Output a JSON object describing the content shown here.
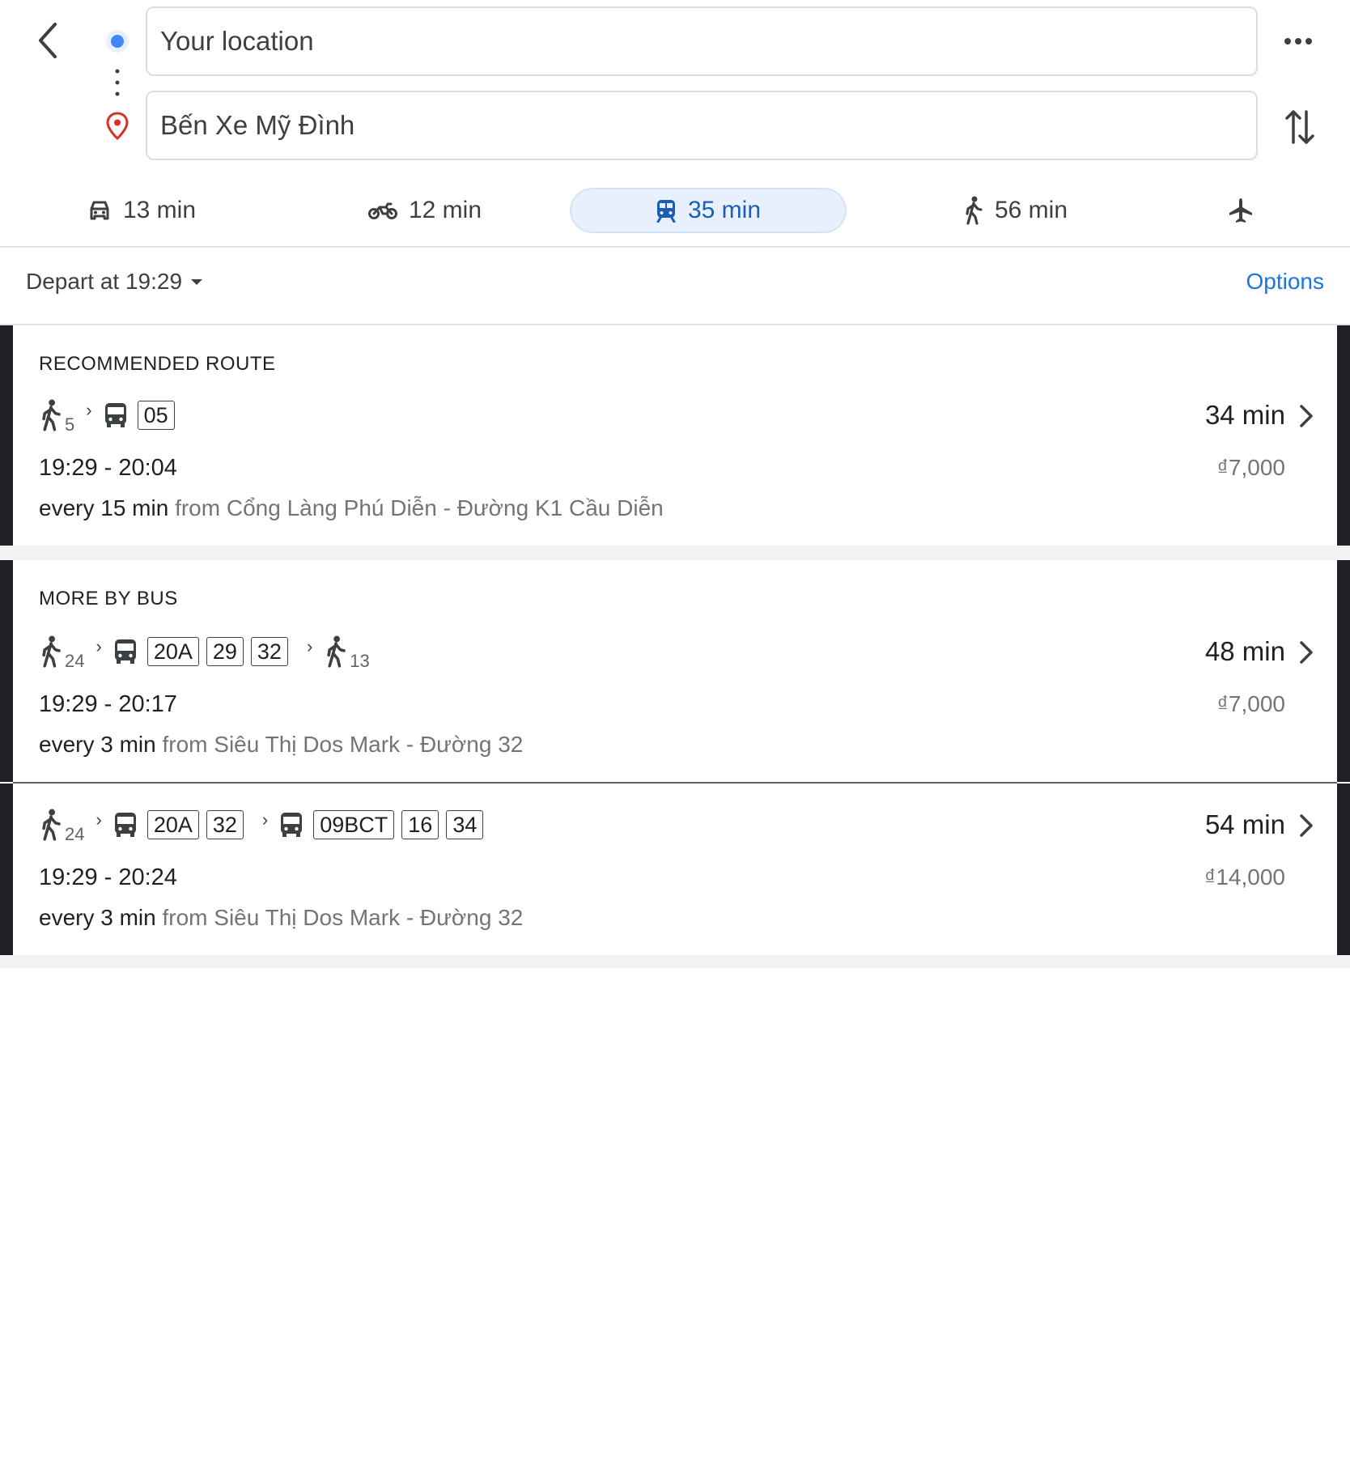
{
  "search": {
    "origin": "Your location",
    "destination": "Bến Xe Mỹ Đình"
  },
  "modes": [
    {
      "name": "driving",
      "label": "13 min",
      "icon": "car-icon"
    },
    {
      "name": "motorbike",
      "label": "12 min",
      "icon": "motorbike-icon"
    },
    {
      "name": "transit",
      "label": "35 min",
      "icon": "train-icon",
      "active": true
    },
    {
      "name": "walking",
      "label": "56 min",
      "icon": "walk-icon"
    },
    {
      "name": "flight",
      "label": "",
      "icon": "airplane-icon"
    }
  ],
  "depart": {
    "label": "Depart at 19:29"
  },
  "options_label": "Options",
  "sections": {
    "recommended": "RECOMMENDED ROUTE",
    "more_by_bus": "MORE BY BUS"
  },
  "routes": [
    {
      "walk_start": "5",
      "buses": [
        [
          "05"
        ]
      ],
      "walk_end": "",
      "duration": "34 min",
      "times": "19:29 - 20:04",
      "price": "₫7,000",
      "frequency": "every 15 min",
      "from": "from Cổng Làng Phú Diễn - Đường K1 Cầu Diễn"
    },
    {
      "walk_start": "24",
      "buses": [
        [
          "20A",
          "29",
          "32"
        ]
      ],
      "walk_end": "13",
      "duration": "48 min",
      "times": "19:29 - 20:17",
      "price": "₫7,000",
      "frequency": "every 3 min",
      "from": "from Siêu Thị Dos Mark - Đường 32"
    },
    {
      "walk_start": "24",
      "buses": [
        [
          "20A",
          "32"
        ],
        [
          "09BCT",
          "16",
          "34"
        ]
      ],
      "walk_end": "",
      "duration": "54 min",
      "times": "19:29 - 20:24",
      "price": "₫14,000",
      "frequency": "every 3 min",
      "from": "from Siêu Thị Dos Mark - Đường 32"
    }
  ],
  "colors": {
    "accent": "#1a73e8",
    "active_tab_bg": "#e8f0fe",
    "origin_dot": "#4285f4",
    "destination_pin": "#d93025"
  }
}
